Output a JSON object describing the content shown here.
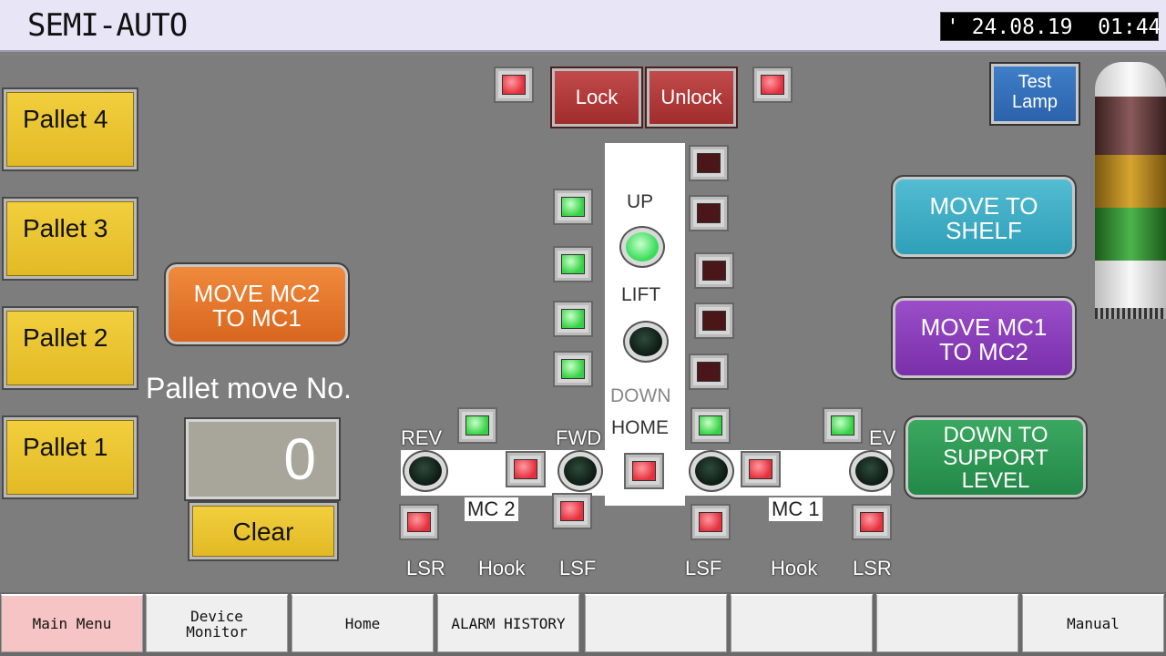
{
  "header": {
    "title": "SEMI-AUTO",
    "datetime": "' 24.08.19  01:44"
  },
  "pallets": [
    {
      "label": "Pallet 4"
    },
    {
      "label": "Pallet 3"
    },
    {
      "label": "Pallet 2"
    },
    {
      "label": "Pallet 1"
    }
  ],
  "move_mc2_to_mc1": {
    "line1": "MOVE  MC2",
    "line2": "TO  MC1"
  },
  "pallet_move": {
    "label": "Pallet move No.",
    "value": "0",
    "clear_label": "Clear"
  },
  "lock": {
    "lock_label": "Lock",
    "unlock_label": "Unlock"
  },
  "test_lamp": {
    "line1": "Test",
    "line2": "Lamp"
  },
  "lift": {
    "up": "UP",
    "lift": "LIFT",
    "down": "DOWN",
    "home": "HOME"
  },
  "right_buttons": {
    "move_to_shelf": {
      "line1": "MOVE TO",
      "line2": "SHELF"
    },
    "move_mc1_to_mc2": {
      "line1": "MOVE  MC1",
      "line2": "TO  MC2"
    },
    "down_to_support": {
      "line1": "DOWN TO",
      "line2": "SUPPORT",
      "line3": "LEVEL"
    }
  },
  "conveyor": {
    "rev_left": "REV",
    "fwd": "FWD",
    "fwd_partial": "",
    "rev_right_partial": "EV",
    "mc2": "MC 2",
    "mc1": "MC 1"
  },
  "sensors": [
    "LSR",
    "Hook",
    "LSF",
    "LSF",
    "Hook",
    "LSR"
  ],
  "footer": {
    "items": [
      "Main Menu",
      "Device\nMonitor",
      "Home",
      "ALARM HISTORY",
      "",
      "",
      "",
      "Manual"
    ]
  },
  "colors": {
    "background": "#7d7d7d",
    "active_nav": "#f6c4c4",
    "lamp_red": "#e52f3c",
    "lamp_green": "#34d244"
  }
}
